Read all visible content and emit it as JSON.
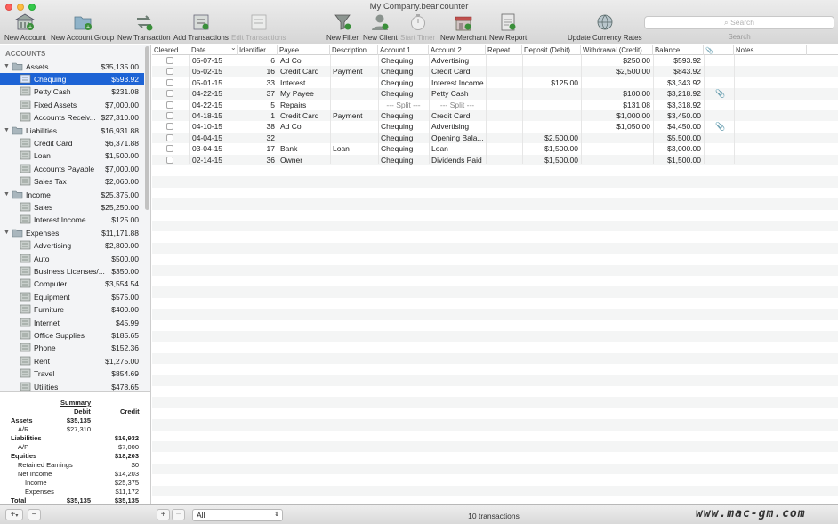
{
  "window": {
    "title": "My Company.beancounter"
  },
  "toolbar": {
    "new_account": "New Account",
    "new_account_group": "New Account Group",
    "new_transaction": "New Transaction",
    "add_transactions": "Add Transactions",
    "edit_transactions": "Edit Transactions",
    "new_filter": "New Filter",
    "new_client": "New Client",
    "start_timer": "Start Timer",
    "new_merchant": "New Merchant",
    "new_report": "New Report",
    "update_currency_rates": "Update Currency Rates",
    "search_placeholder": "Search",
    "search_label": "Search"
  },
  "sidebar": {
    "header": "ACCOUNTS",
    "groups": [
      {
        "name": "Assets",
        "amount": "$35,135.00",
        "items": [
          {
            "name": "Chequing",
            "amount": "$593.92",
            "selected": true
          },
          {
            "name": "Petty Cash",
            "amount": "$231.08"
          },
          {
            "name": "Fixed Assets",
            "amount": "$7,000.00"
          },
          {
            "name": "Accounts Receiv...",
            "amount": "$27,310.00"
          }
        ]
      },
      {
        "name": "Liabilities",
        "amount": "$16,931.88",
        "items": [
          {
            "name": "Credit Card",
            "amount": "$6,371.88"
          },
          {
            "name": "Loan",
            "amount": "$1,500.00"
          },
          {
            "name": "Accounts Payable",
            "amount": "$7,000.00"
          },
          {
            "name": "Sales Tax",
            "amount": "$2,060.00"
          }
        ]
      },
      {
        "name": "Income",
        "amount": "$25,375.00",
        "items": [
          {
            "name": "Sales",
            "amount": "$25,250.00"
          },
          {
            "name": "Interest Income",
            "amount": "$125.00"
          }
        ]
      },
      {
        "name": "Expenses",
        "amount": "$11,171.88",
        "items": [
          {
            "name": "Advertising",
            "amount": "$2,800.00"
          },
          {
            "name": "Auto",
            "amount": "$500.00"
          },
          {
            "name": "Business Licenses/...",
            "amount": "$350.00"
          },
          {
            "name": "Computer",
            "amount": "$3,554.54"
          },
          {
            "name": "Equipment",
            "amount": "$575.00"
          },
          {
            "name": "Furniture",
            "amount": "$400.00"
          },
          {
            "name": "Internet",
            "amount": "$45.99"
          },
          {
            "name": "Office Supplies",
            "amount": "$185.65"
          },
          {
            "name": "Phone",
            "amount": "$152.36"
          },
          {
            "name": "Rent",
            "amount": "$1,275.00"
          },
          {
            "name": "Travel",
            "amount": "$854.69"
          },
          {
            "name": "Utilities",
            "amount": "$478.65"
          }
        ]
      }
    ]
  },
  "summary": {
    "title": "Summary",
    "debit_header": "Debit",
    "credit_header": "Credit",
    "rows": [
      {
        "label": "Assets",
        "debit": "$35,135",
        "credit": "",
        "bold": true,
        "indent": 0
      },
      {
        "label": "A/R",
        "debit": "$27,310",
        "credit": "",
        "bold": false,
        "indent": 1
      },
      {
        "label": "Liabilities",
        "debit": "",
        "credit": "$16,932",
        "bold": true,
        "indent": 0
      },
      {
        "label": "A/P",
        "debit": "",
        "credit": "$7,000",
        "bold": false,
        "indent": 1
      },
      {
        "label": "Equities",
        "debit": "",
        "credit": "$18,203",
        "bold": true,
        "indent": 0
      },
      {
        "label": "Retained Earnings",
        "debit": "",
        "credit": "$0",
        "bold": false,
        "indent": 1
      },
      {
        "label": "Net Income",
        "debit": "",
        "credit": "$14,203",
        "bold": false,
        "indent": 1
      },
      {
        "label": "Income",
        "debit": "",
        "credit": "$25,375",
        "bold": false,
        "indent": 2
      },
      {
        "label": "Expenses",
        "debit": "",
        "credit": "$11,172",
        "bold": false,
        "indent": 2
      },
      {
        "label": "Total",
        "debit": "$35,135",
        "credit": "$35,135",
        "bold": true,
        "indent": 0
      }
    ]
  },
  "table": {
    "columns": [
      "Cleared",
      "Date",
      "Identifier",
      "Payee",
      "Description",
      "Account 1",
      "Account 2",
      "Repeat",
      "Deposit (Debit)",
      "Withdrawal (Credit)",
      "Balance",
      "Notes"
    ],
    "rows": [
      {
        "date": "05-07-15",
        "id": "6",
        "payee": "Ad Co",
        "desc": "",
        "acc1": "Chequing",
        "acc2": "Advertising",
        "repeat": "",
        "deposit": "",
        "withdrawal": "$250.00",
        "balance": "$593.92",
        "attach": false
      },
      {
        "date": "05-02-15",
        "id": "16",
        "payee": "Credit Card",
        "desc": "Payment",
        "acc1": "Chequing",
        "acc2": "Credit Card",
        "repeat": "",
        "deposit": "",
        "withdrawal": "$2,500.00",
        "balance": "$843.92",
        "attach": false
      },
      {
        "date": "05-01-15",
        "id": "33",
        "payee": "Interest",
        "desc": "",
        "acc1": "Chequing",
        "acc2": "Interest Income",
        "repeat": "",
        "deposit": "$125.00",
        "withdrawal": "",
        "balance": "$3,343.92",
        "attach": false
      },
      {
        "date": "04-22-15",
        "id": "37",
        "payee": "My Payee",
        "desc": "",
        "acc1": "Chequing",
        "acc2": "Petty Cash",
        "repeat": "",
        "deposit": "",
        "withdrawal": "$100.00",
        "balance": "$3,218.92",
        "attach": true
      },
      {
        "date": "04-22-15",
        "id": "5",
        "payee": "Repairs",
        "desc": "",
        "acc1": "--- Split ---",
        "acc2": "--- Split ---",
        "repeat": "",
        "deposit": "",
        "withdrawal": "$131.08",
        "balance": "$3,318.92",
        "attach": false
      },
      {
        "date": "04-18-15",
        "id": "1",
        "payee": "Credit Card",
        "desc": "Payment",
        "acc1": "Chequing",
        "acc2": "Credit Card",
        "repeat": "",
        "deposit": "",
        "withdrawal": "$1,000.00",
        "balance": "$3,450.00",
        "attach": false
      },
      {
        "date": "04-10-15",
        "id": "38",
        "payee": "Ad Co",
        "desc": "",
        "acc1": "Chequing",
        "acc2": "Advertising",
        "repeat": "",
        "deposit": "",
        "withdrawal": "$1,050.00",
        "balance": "$4,450.00",
        "attach": true
      },
      {
        "date": "04-04-15",
        "id": "32",
        "payee": "",
        "desc": "",
        "acc1": "Chequing",
        "acc2": "Opening Bala...",
        "repeat": "",
        "deposit": "$2,500.00",
        "withdrawal": "",
        "balance": "$5,500.00",
        "attach": false
      },
      {
        "date": "03-04-15",
        "id": "17",
        "payee": "Bank",
        "desc": "Loan",
        "acc1": "Chequing",
        "acc2": "Loan",
        "repeat": "",
        "deposit": "$1,500.00",
        "withdrawal": "",
        "balance": "$3,000.00",
        "attach": false
      },
      {
        "date": "02-14-15",
        "id": "36",
        "payee": "Owner",
        "desc": "",
        "acc1": "Chequing",
        "acc2": "Dividends Paid",
        "repeat": "",
        "deposit": "$1,500.00",
        "withdrawal": "",
        "balance": "$1,500.00",
        "attach": false
      }
    ]
  },
  "footer": {
    "filter_value": "All",
    "transaction_count": "10 transactions",
    "add_symbol": "+",
    "remove_symbol": "−"
  },
  "watermark": "www.mac-gm.com",
  "colors": {
    "selection": "#1d63d5",
    "toolbar": "#dcdcdc"
  }
}
